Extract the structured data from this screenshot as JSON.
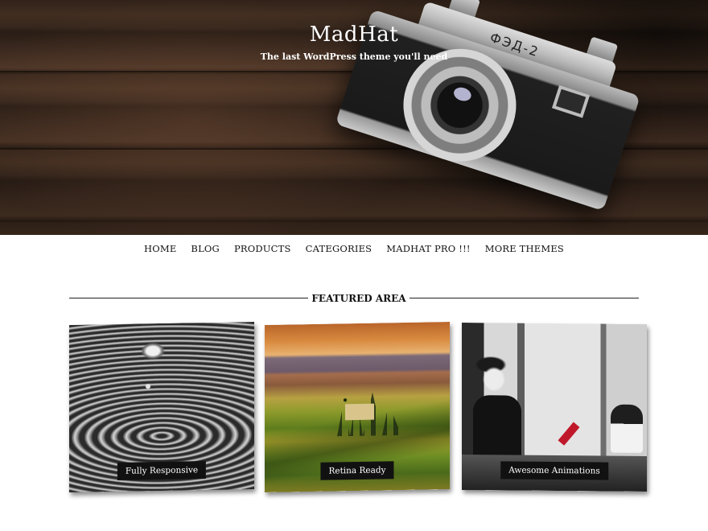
{
  "site": {
    "title": "MadHat",
    "tagline": "The last WordPress theme you'll need"
  },
  "nav": {
    "items": [
      {
        "label": "HOME"
      },
      {
        "label": "BLOG"
      },
      {
        "label": "PRODUCTS"
      },
      {
        "label": "CATEGORIES"
      },
      {
        "label": "MADHAT PRO !!!"
      },
      {
        "label": "MORE THEMES"
      }
    ]
  },
  "camera": {
    "model_text": "ФЭД-2"
  },
  "featured": {
    "title": "FEATURED AREA",
    "cards": [
      {
        "caption": "Fully Responsive",
        "image": "water-droplet-photo"
      },
      {
        "caption": "Retina Ready",
        "image": "tuscany-landscape-photo"
      },
      {
        "caption": "Awesome Animations",
        "image": "woman-with-dog-photo"
      }
    ]
  }
}
